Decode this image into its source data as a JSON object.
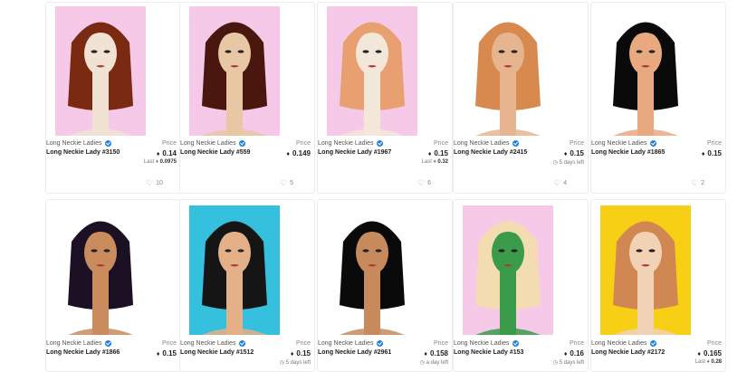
{
  "cards": [
    {
      "collection": "Long Neckie Ladies",
      "name": "Long Neckie Lady #3150",
      "price_label": "Price",
      "price": "0.14",
      "meta_label": "Last",
      "meta_value": "0.0975",
      "likes": "10",
      "bg": "#f7c9e8",
      "hair": "#7a2a10",
      "skin": "#f1e3d3"
    },
    {
      "collection": "Long Neckie Ladies",
      "name": "Long Neckie Lady #559",
      "price_label": "Price",
      "price": "0.149",
      "meta_label": "",
      "meta_value": "",
      "likes": "5",
      "bg": "#f7c9e8",
      "hair": "#4a170f",
      "skin": "#e8c7a5"
    },
    {
      "collection": "Long Neckie Ladies",
      "name": "Long Neckie Lady #1967",
      "price_label": "Price",
      "price": "0.15",
      "meta_label": "Last",
      "meta_value": "0.32",
      "likes": "6",
      "bg": "#f7c9e8",
      "hair": "#e8a070",
      "skin": "#f3e7da"
    },
    {
      "collection": "Long Neckie Ladies",
      "name": "Long Neckie Lady #2415",
      "price_label": "Price",
      "price": "0.15",
      "meta_label": "",
      "meta_value": "5 days left",
      "likes": "4",
      "bg": "#ffffff",
      "hair": "#d7894e",
      "skin": "#e6b590"
    },
    {
      "collection": "Long Neckie Ladies",
      "name": "Long Neckie Lady #1865",
      "price_label": "Price",
      "price": "0.15",
      "meta_label": "",
      "meta_value": "",
      "likes": "2",
      "bg": "#ffffff",
      "hair": "#0a0a0a",
      "skin": "#e8a980"
    },
    {
      "collection": "Long Neckie Ladies",
      "name": "Long Neckie Lady #1866",
      "price_label": "Price",
      "price": "0.15",
      "meta_label": "",
      "meta_value": "",
      "likes": "",
      "bg": "#ffffff",
      "hair": "#1b1024",
      "skin": "#ca8c5d"
    },
    {
      "collection": "Long Neckie Ladies",
      "name": "Long Neckie Lady #1512",
      "price_label": "Price",
      "price": "0.15",
      "meta_label": "",
      "meta_value": "5 days left",
      "likes": "",
      "bg": "#35c0dd",
      "hair": "#151515",
      "skin": "#e4b088"
    },
    {
      "collection": "Long Neckie Ladies",
      "name": "Long Neckie Lady #2961",
      "price_label": "Price",
      "price": "0.158",
      "meta_label": "",
      "meta_value": "a day left",
      "likes": "",
      "bg": "#ffffff",
      "hair": "#0a0a0a",
      "skin": "#c78a5c"
    },
    {
      "collection": "Long Neckie Ladies",
      "name": "Long Neckie Lady #153",
      "price_label": "Price",
      "price": "0.16",
      "meta_label": "",
      "meta_value": "5 days left",
      "likes": "",
      "bg": "#f7c9e8",
      "hair": "#f3ddb0",
      "skin": "#3a9b4a"
    },
    {
      "collection": "Long Neckie Ladies",
      "name": "Long Neckie Lady #2172",
      "price_label": "Price",
      "price": "0.165",
      "meta_label": "Last",
      "meta_value": "0.28",
      "likes": "",
      "bg": "#f7cf15",
      "hair": "#d08752",
      "skin": "#f1d2b4"
    }
  ]
}
